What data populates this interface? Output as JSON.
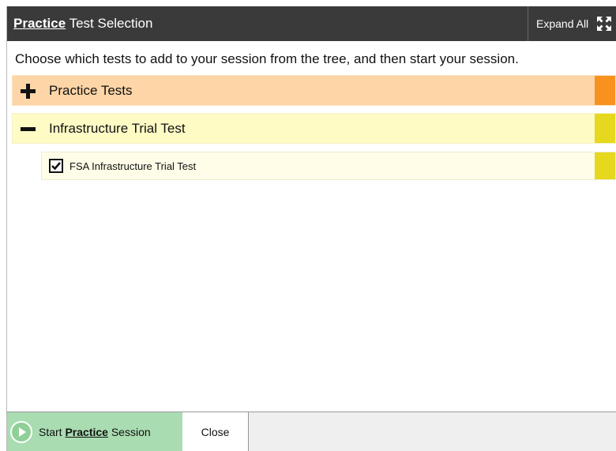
{
  "dialog": {
    "title_keyword": "Practice",
    "title_rest": " Test Selection",
    "expand_all_label": "Expand All"
  },
  "instructions": "Choose which tests to add to your session from the tree, and then start your session.",
  "tree": {
    "practice_tests": {
      "label": "Practice Tests",
      "state": "collapsed"
    },
    "infrastructure": {
      "label": "Infrastructure Trial Test",
      "state": "expanded"
    },
    "fsa_item": {
      "label": "FSA Infrastructure Trial Test",
      "checked": true
    }
  },
  "footer": {
    "start_prefix": "Start ",
    "start_keyword": "Practice",
    "start_suffix": " Session",
    "close_label": "Close"
  },
  "colors": {
    "titlebar": "#3a3a3a",
    "practice_row": "#fdd5a6",
    "practice_accent": "#f7921e",
    "infra_row": "#fefbc5",
    "infra_accent": "#e5d81e",
    "start_button": "#a9dcb1"
  },
  "icons": {
    "expand": "expand-arrows-icon",
    "toggle_collapsed": "plus-icon",
    "toggle_expanded": "minus-icon",
    "check": "checkmark-icon",
    "start": "play-circle-icon"
  }
}
